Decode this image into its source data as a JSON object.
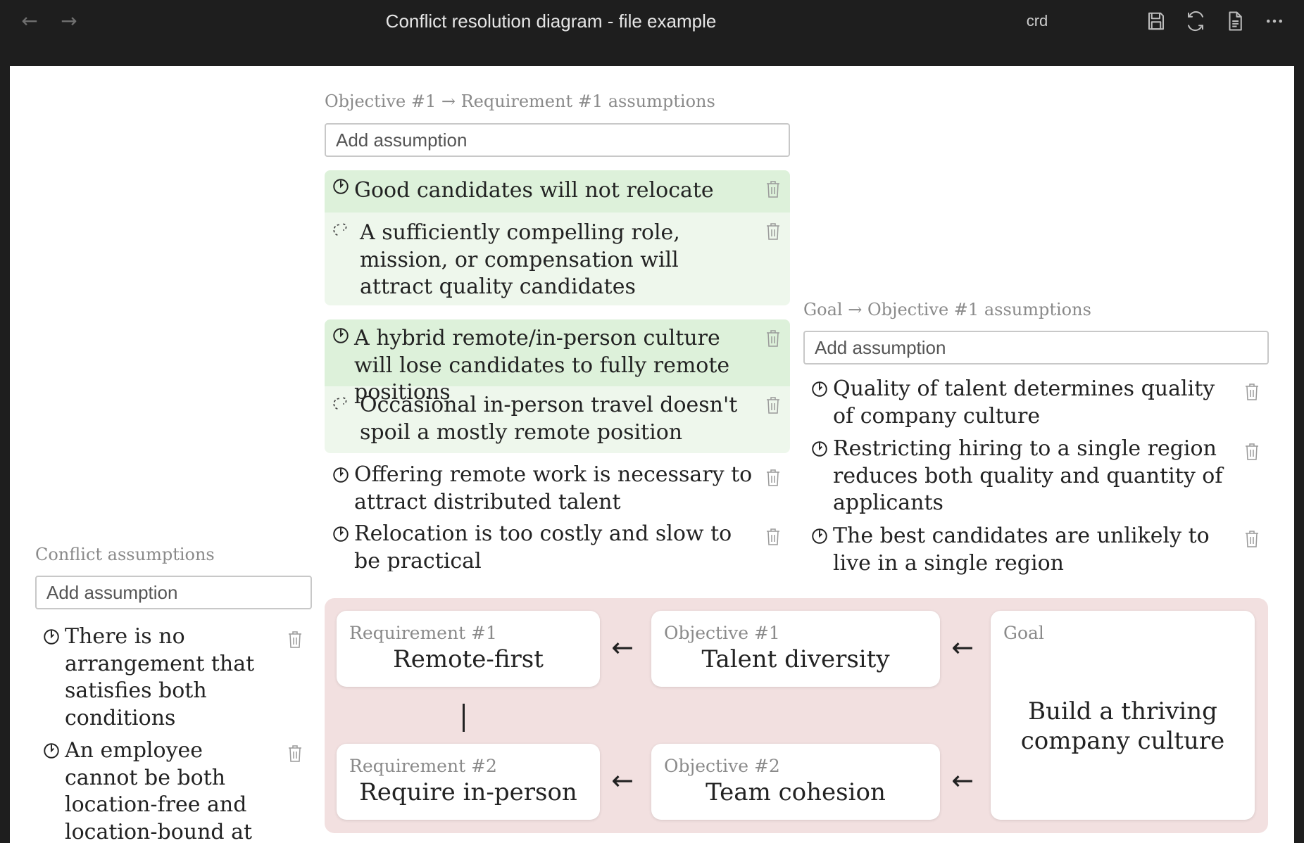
{
  "window": {
    "title": "Conflict resolution diagram - file example",
    "file_type": "crd",
    "back_icon": "arrow-left-icon",
    "forward_icon": "arrow-right-icon"
  },
  "toolbar": {
    "icons": [
      "save-icon",
      "refresh-icon",
      "document-icon",
      "more-icon"
    ]
  },
  "sections": {
    "obj1_req1": {
      "label": "Objective #1 → Requirement #1 assumptions",
      "placeholder": "Add assumption",
      "groups": [
        {
          "primary": "Good candidates will not relocate",
          "challenge": "A sufficiently compelling role, mission, or compensation will attract quality candidates"
        },
        {
          "primary": "A hybrid remote/in-person culture will lose candidates to fully remote positions",
          "challenge": "Occasional in-person travel doesn't spoil a mostly remote position"
        }
      ],
      "items": [
        "Offering remote work is necessary to attract distributed talent",
        "Relocation is too costly and slow to be practical"
      ]
    },
    "goal_obj1": {
      "label": "Goal → Objective #1 assumptions",
      "placeholder": "Add assumption",
      "items": [
        "Quality of talent determines quality of company culture",
        "Restricting hiring to a single region reduces both quality and quantity of applicants",
        "The best candidates are unlikely to live in a single region"
      ]
    },
    "conflict": {
      "label": "Conflict assumptions",
      "placeholder": "Add assumption",
      "items": [
        "There is no arrangement that satisfies both conditions",
        "An employee cannot be both location-free and location-bound at the same time"
      ]
    }
  },
  "diagram": {
    "req1": {
      "label": "Requirement #1",
      "title": "Remote-first"
    },
    "req2": {
      "label": "Requirement #2",
      "title": "Require in-person"
    },
    "obj1": {
      "label": "Objective #1",
      "title": "Talent diversity"
    },
    "obj2": {
      "label": "Objective #2",
      "title": "Team cohesion"
    },
    "goal": {
      "label": "Goal",
      "title": "Build a thriving company culture"
    },
    "arrow_glyph": "←"
  },
  "colors": {
    "titlebar_bg": "#1e1e1e",
    "assumption_group_bg": "#eef7ec",
    "assumption_primary_bg": "#ddf1da",
    "diagram_bg": "#f2e0e0",
    "muted_text": "#8a8a8a"
  }
}
